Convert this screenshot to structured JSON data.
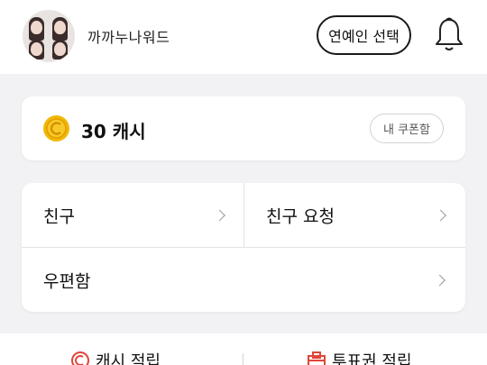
{
  "header": {
    "username": "까까누나워드",
    "celeb_select_label": "연예인 선택",
    "avatar_icon": "profile-photo",
    "bell_icon": "bell-icon"
  },
  "cash": {
    "amount_text": "30 캐시",
    "coupon_button_label": "내 쿠폰함",
    "coin_icon": "coin-icon",
    "coin_color": "#f2b705"
  },
  "menu": {
    "items": [
      {
        "label": "친구"
      },
      {
        "label": "친구 요청"
      },
      {
        "label": "우편함"
      }
    ]
  },
  "bottom": {
    "left_label": "캐시 적립",
    "right_label": "투표권 적립",
    "left_icon": "cash-earn-icon",
    "right_icon": "ticket-earn-icon",
    "accent_color": "#e0453a"
  }
}
